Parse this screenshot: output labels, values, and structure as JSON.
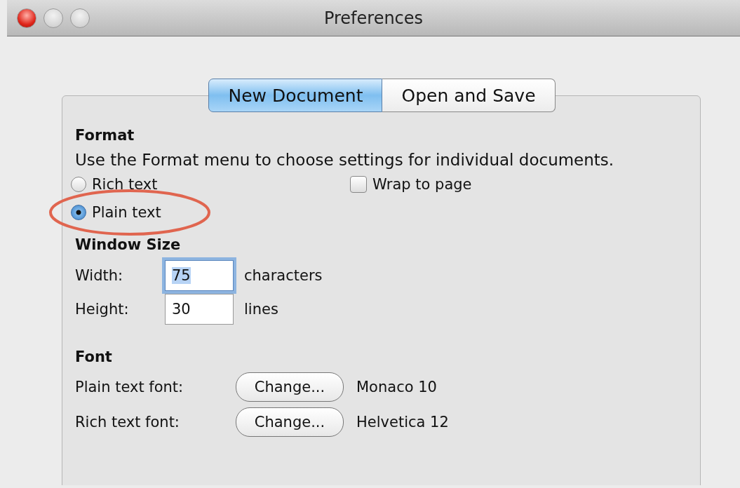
{
  "window": {
    "title": "Preferences",
    "controls": [
      {
        "kind": "close"
      },
      {
        "kind": "minimize"
      },
      {
        "kind": "zoom"
      }
    ]
  },
  "tabs": [
    {
      "label": "New Document",
      "selected": true
    },
    {
      "label": "Open and Save",
      "selected": false
    }
  ],
  "format": {
    "heading": "Format",
    "description": "Use the Format menu to choose settings for individual documents.",
    "options": [
      {
        "label": "Rich text",
        "selected": false,
        "highlighted": false
      },
      {
        "label": "Plain text",
        "selected": true,
        "highlighted": true
      }
    ],
    "wrap_to_page": {
      "label": "Wrap to page",
      "checked": false
    }
  },
  "window_size": {
    "heading": "Window Size",
    "fields": [
      {
        "label": "Width:",
        "value": "75",
        "unit": "characters",
        "focused": true
      },
      {
        "label": "Height:",
        "value": "30",
        "unit": "lines",
        "focused": false
      }
    ]
  },
  "font": {
    "heading": "Font",
    "rows": [
      {
        "label": "Plain text font:",
        "button": "Change...",
        "font": "Monaco 10"
      },
      {
        "label": "Rich text font:",
        "button": "Change...",
        "font": "Helvetica 12"
      }
    ]
  }
}
